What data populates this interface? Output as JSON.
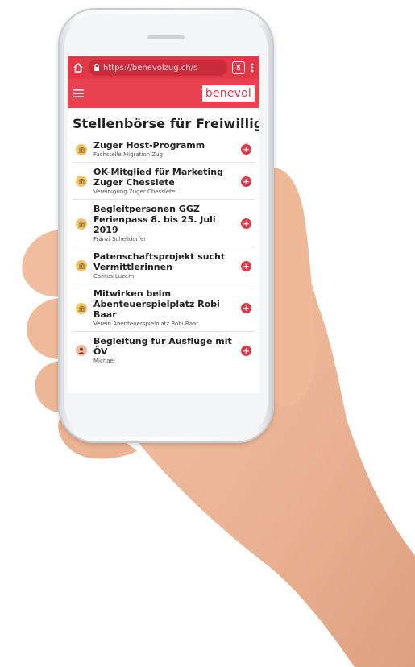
{
  "browser": {
    "url": "https://benevolzug.ch/s",
    "tabs_count": "5"
  },
  "app": {
    "logo": "benevol"
  },
  "page": {
    "title": "Stellenbörse für Freiwillige"
  },
  "listings": [
    {
      "title": "Zuger Host-Programm",
      "org": "Fachstelle Migration Zug",
      "icon": "building-icon"
    },
    {
      "title": "OK-Mitglied für Marketing Zuger Chesslete",
      "org": "Vereinigung Zuger Chesslete",
      "icon": "building-icon"
    },
    {
      "title": "Begleitpersonen GGZ Ferienpass 8. bis 25. Juli 2019",
      "org": "Fränzi Schelldorfer",
      "icon": "building-icon"
    },
    {
      "title": "Patenschaftsprojekt sucht Vermittlerinnen",
      "org": "Caritas Luzern",
      "icon": "building-icon"
    },
    {
      "title": "Mitwirken beim Abenteuerspielplatz Robi Baar",
      "org": "Verein Abenteuerspielplatz Robi Baar",
      "icon": "building-icon"
    },
    {
      "title": "Begleitung für Ausflüge mit ÖV",
      "org": "Michael",
      "icon": "person-avatar-icon"
    }
  ],
  "colors": {
    "brand_red": "#e33647",
    "org_icon": "#f1c565"
  }
}
